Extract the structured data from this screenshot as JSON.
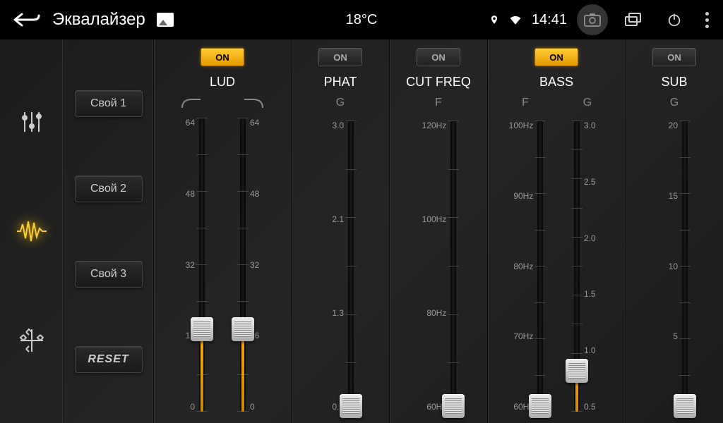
{
  "status": {
    "title": "Эквалайзер",
    "temperature": "18°C",
    "time": "14:41"
  },
  "presets": {
    "p1": "Свой 1",
    "p2": "Свой 2",
    "p3": "Свой 3",
    "reset": "RESET"
  },
  "on_label": "ON",
  "columns": {
    "lud": {
      "label": "LUD",
      "on": true,
      "sliders": [
        {
          "ticks": [
            "64",
            "48",
            "32",
            "16",
            "0"
          ],
          "value_pct": 28
        },
        {
          "ticks": [
            "64",
            "48",
            "32",
            "16",
            "0"
          ],
          "value_pct": 28
        }
      ]
    },
    "phat": {
      "label": "PHAT",
      "on": false,
      "sliders": [
        {
          "sub": "G",
          "ticks": [
            "3.0",
            "2.1",
            "1.3",
            "0.5"
          ],
          "value_pct": 2
        }
      ]
    },
    "cutfreq": {
      "label": "CUT FREQ",
      "on": false,
      "sliders": [
        {
          "sub": "F",
          "ticks": [
            "120Hz",
            "100Hz",
            "80Hz",
            "60Hz"
          ],
          "value_pct": 2
        }
      ]
    },
    "bass": {
      "label": "BASS",
      "on": true,
      "sliders": [
        {
          "sub": "F",
          "ticks": [
            "100Hz",
            "90Hz",
            "80Hz",
            "70Hz",
            "60Hz"
          ],
          "value_pct": 2
        },
        {
          "sub": "G",
          "ticks": [
            "3.0",
            "2.5",
            "2.0",
            "1.5",
            "1.0",
            "0.5"
          ],
          "value_pct": 14
        }
      ]
    },
    "sub": {
      "label": "SUB",
      "on": false,
      "sliders": [
        {
          "sub": "G",
          "ticks": [
            "20",
            "15",
            "10",
            "5",
            "0"
          ],
          "value_pct": 2
        }
      ]
    }
  }
}
